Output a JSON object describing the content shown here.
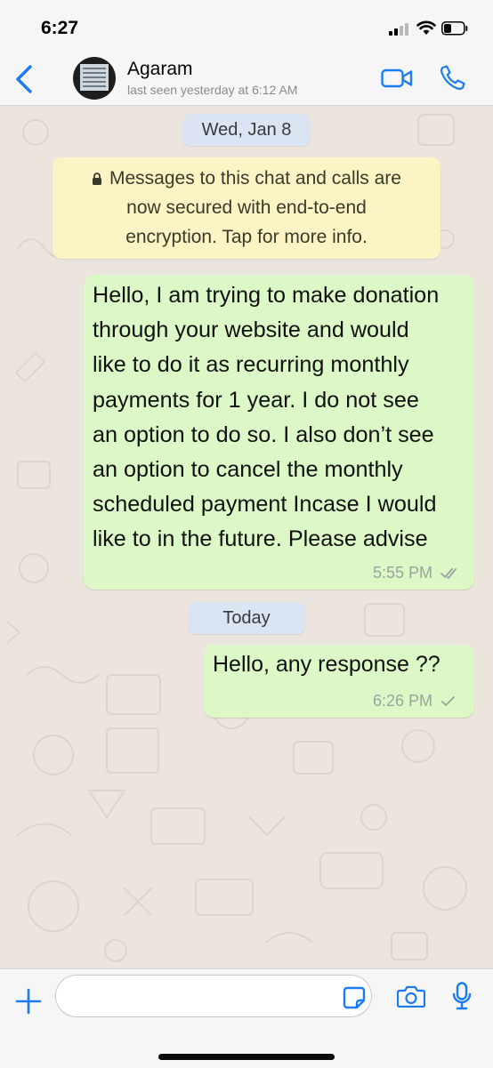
{
  "status_bar": {
    "time": "6:27"
  },
  "header": {
    "contact_name": "Agaram",
    "last_seen": "last seen yesterday at 6:12 AM",
    "accent": "#1a7bf2"
  },
  "chat": {
    "date_1": "Wed, Jan 8",
    "encryption_notice": [
      "Messages to this chat and calls are",
      "now secured with end-to-end",
      "encryption. Tap for more info."
    ],
    "messages": [
      {
        "lines": [
          "Hello, I am trying to make donation",
          "through your website and would",
          "like to do it as recurring monthly",
          "payments for 1 year. I do not see",
          "an option to do so. I also don’t see",
          "an option to cancel the monthly",
          "scheduled payment Incase I would",
          "like to in the future. Please advise"
        ],
        "time": "5:55 PM",
        "status": "double-check-icon"
      },
      {
        "text": "Hello, any response ??",
        "time": "6:26 PM",
        "status": "single-check-icon"
      }
    ],
    "date_2": "Today",
    "bubble_color": "#dcf8c6"
  },
  "input_bar": {
    "value": "",
    "placeholder": ""
  }
}
